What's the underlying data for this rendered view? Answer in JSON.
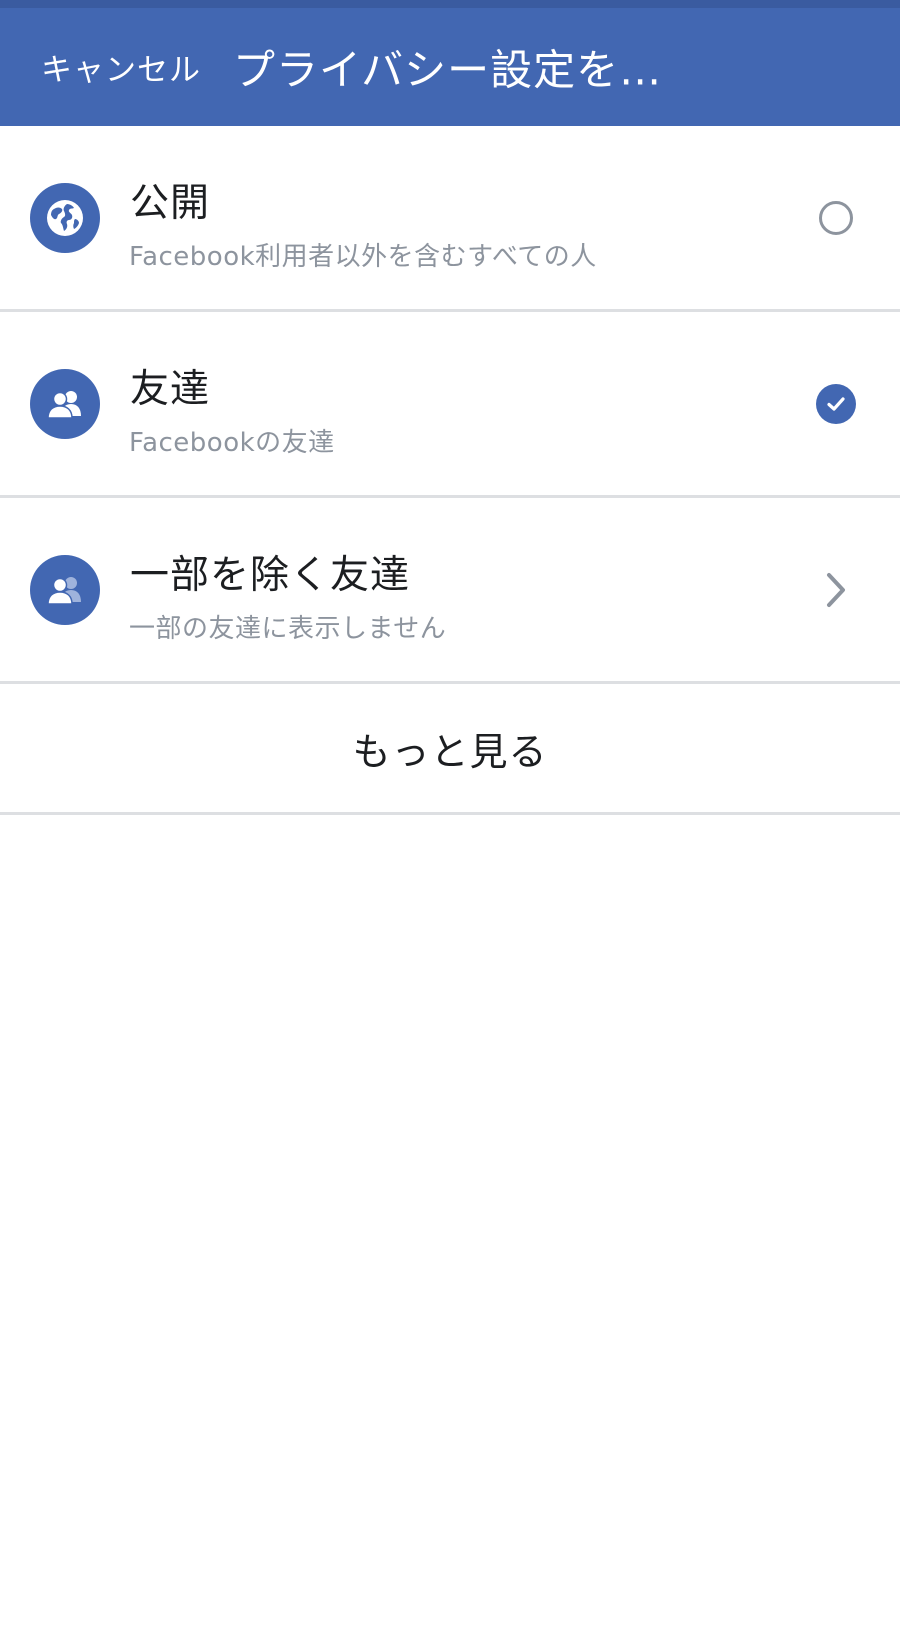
{
  "header": {
    "cancel_label": "キャンセル",
    "title": "プライバシー設定を…"
  },
  "options": [
    {
      "title": "公開",
      "subtitle": "Facebook利用者以外を含むすべての人",
      "icon": "globe-icon",
      "control": "radio",
      "selected": false
    },
    {
      "title": "友達",
      "subtitle": "Facebookの友達",
      "icon": "friends-icon",
      "control": "radio",
      "selected": true
    },
    {
      "title": "一部を除く友達",
      "subtitle": "一部の友達に表示しません",
      "icon": "friends-except-icon",
      "control": "chevron",
      "selected": false
    }
  ],
  "more_label": "もっと見る",
  "colors": {
    "brand": "#4267b2",
    "divider": "#dddfe2",
    "secondary_text": "#8d949e",
    "primary_text": "#1c1e21"
  }
}
